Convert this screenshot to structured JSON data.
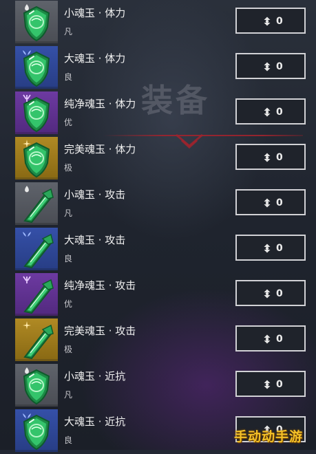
{
  "background": {
    "title": "装备"
  },
  "watermark": "手动动手游",
  "items": [
    {
      "name": "小魂玉 · 体力",
      "grade": "凡",
      "rarity": "fan",
      "icon": "shield-gem-icon",
      "quantity": "0"
    },
    {
      "name": "大魂玉 · 体力",
      "grade": "良",
      "rarity": "liang",
      "icon": "shield-gem-icon",
      "quantity": "0"
    },
    {
      "name": "纯净魂玉 · 体力",
      "grade": "优",
      "rarity": "you",
      "icon": "shield-gem-icon",
      "quantity": "0"
    },
    {
      "name": "完美魂玉 · 体力",
      "grade": "极",
      "rarity": "ji",
      "icon": "shield-gem-icon",
      "quantity": "0"
    },
    {
      "name": "小魂玉 · 攻击",
      "grade": "凡",
      "rarity": "fan",
      "icon": "blade-gem-icon",
      "quantity": "0"
    },
    {
      "name": "大魂玉 · 攻击",
      "grade": "良",
      "rarity": "liang",
      "icon": "blade-gem-icon",
      "quantity": "0"
    },
    {
      "name": "纯净魂玉 · 攻击",
      "grade": "优",
      "rarity": "you",
      "icon": "blade-gem-icon",
      "quantity": "0"
    },
    {
      "name": "完美魂玉 · 攻击",
      "grade": "极",
      "rarity": "ji",
      "icon": "blade-gem-icon",
      "quantity": "0"
    },
    {
      "name": "小魂玉 · 近抗",
      "grade": "凡",
      "rarity": "fan",
      "icon": "shield-gem-icon",
      "quantity": "0"
    },
    {
      "name": "大魂玉 · 近抗",
      "grade": "良",
      "rarity": "liang",
      "icon": "shield-gem-icon",
      "quantity": "0"
    }
  ],
  "colors": {
    "fan": "#5f636b",
    "liang": "#3550a8",
    "you": "#6d3aa1",
    "ji": "#b08a24",
    "gem": "#2fbf63",
    "watermark": "#f2c028"
  }
}
